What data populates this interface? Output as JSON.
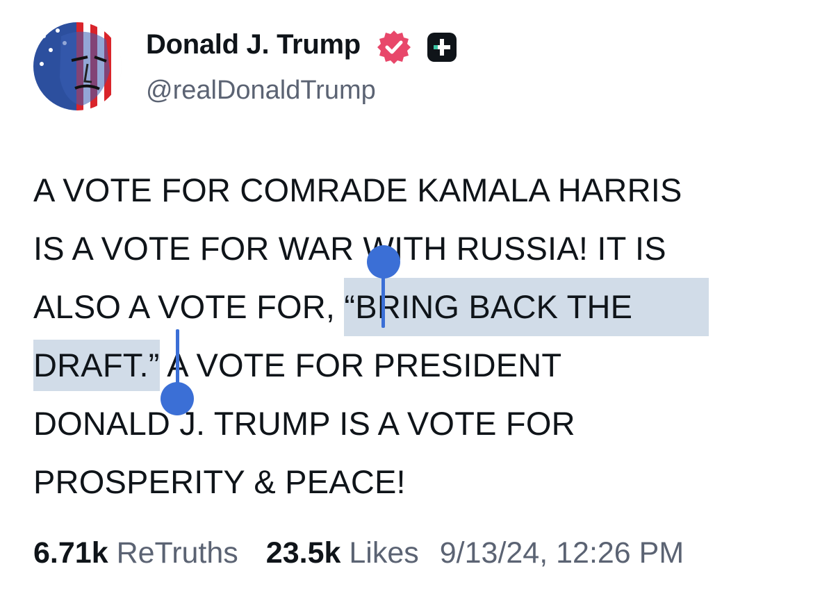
{
  "post": {
    "author_name": "Donald J. Trump",
    "handle": "@realDonaldTrump",
    "lines": [
      "A VOTE FOR COMRADE KAMALA HARRIS",
      "IS A VOTE FOR WAR WITH RUSSIA! IT IS",
      "ALSO A VOTE FOR, ",
      "“BRING BACK THE",
      "DRAFT.”",
      " A VOTE FOR PRESIDENT",
      "DONALD J. TRUMP IS A VOTE FOR",
      "PROSPERITY & PEACE!"
    ]
  },
  "stats": {
    "retruths_count": "6.71k",
    "retruths_label": "ReTruths",
    "likes_count": "23.5k",
    "likes_label": "Likes",
    "timestamp": "9/13/24, 12:26 PM"
  },
  "icons": {
    "verified": "verified-badge-icon",
    "plus": "plus-badge-icon"
  },
  "colors": {
    "selection_highlight": "#d1dce8",
    "selection_handle": "#3b6fd6",
    "verified_badge": "#e8476a",
    "secondary_text": "#5b6373"
  }
}
